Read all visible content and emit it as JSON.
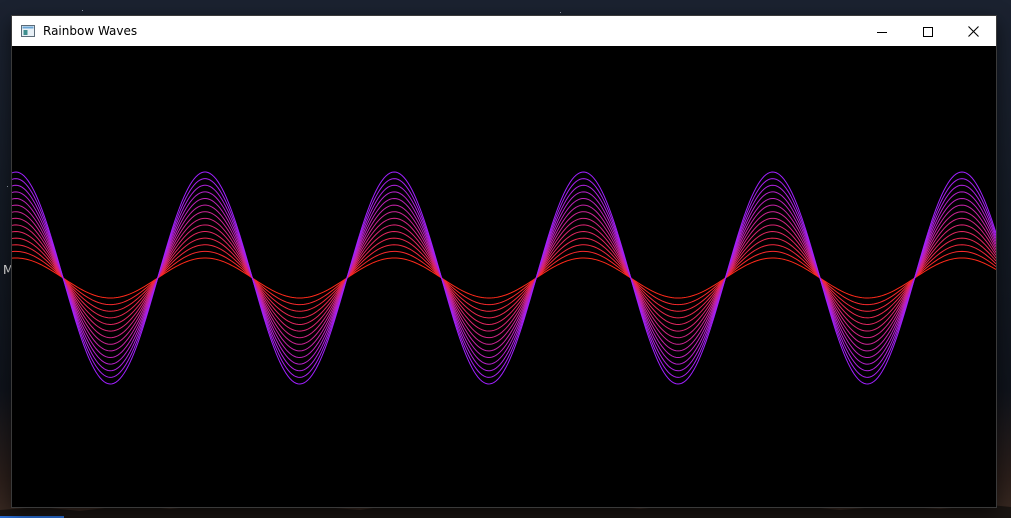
{
  "window": {
    "title": "Rainbow Waves"
  },
  "titlebar_controls": {
    "minimize_icon": "minimize-icon",
    "maximize_icon": "maximize-icon",
    "close_icon": "close-icon"
  },
  "desktop": {
    "edge_text": "M"
  },
  "canvas": {
    "background": "#000000",
    "wave_count": 5,
    "curve_count": 14,
    "color_from": "#ff2a1a",
    "color_to": "#a020ff",
    "accent": "#ff00cc"
  }
}
